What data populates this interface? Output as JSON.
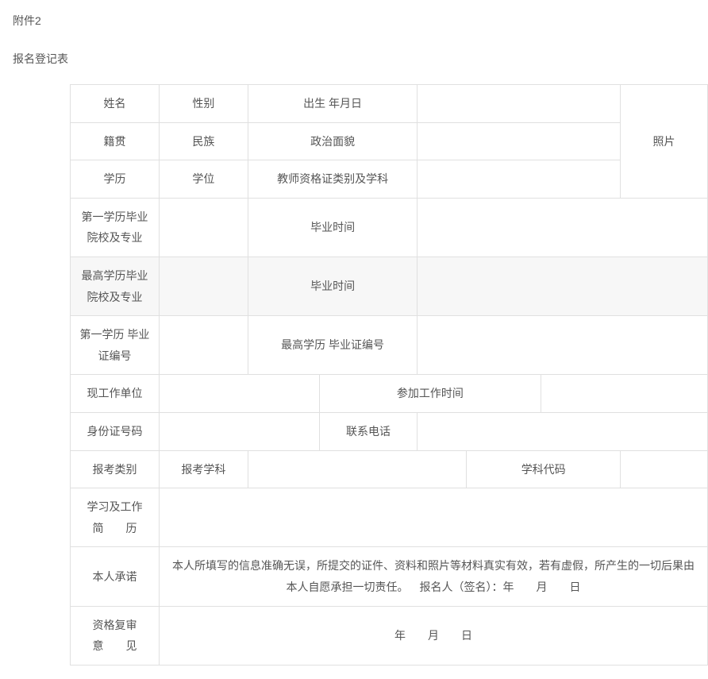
{
  "header": {
    "attachment_label": "附件2",
    "form_title": "报名登记表"
  },
  "labels": {
    "name": "姓名",
    "gender": "性别",
    "birth": "出生 年月日",
    "photo": "照片",
    "native_place": "籍贯",
    "ethnicity": "民族",
    "political_status": "政治面貌",
    "education": "学历",
    "degree": "学位",
    "teacher_cert": "教师资格证类别及学科",
    "first_edu_school": "第一学历毕业院校及专业",
    "grad_time": "毕业时间",
    "highest_edu_school": "最高学历毕业院校及专业",
    "first_cert_no": "第一学历 毕业证编号",
    "highest_cert_no": "最高学历 毕业证编号",
    "current_employer": "现工作单位",
    "work_start": "参加工作时间",
    "id_number": "身份证号码",
    "phone": "联系电话",
    "exam_category": "报考类别",
    "exam_subject": "报考学科",
    "subject_code": "学科代码",
    "resume": "学习及工作简  历",
    "commitment": "本人承诺",
    "commitment_text": "本人所填写的信息准确无误，所提交的证件、资料和照片等材料真实有效，若有虚假，所产生的一切后果由本人自愿承担一切责任。 报名人（签名）：年  月  日",
    "review_opinion": "资格复审意  见",
    "review_date": "年  月  日"
  }
}
